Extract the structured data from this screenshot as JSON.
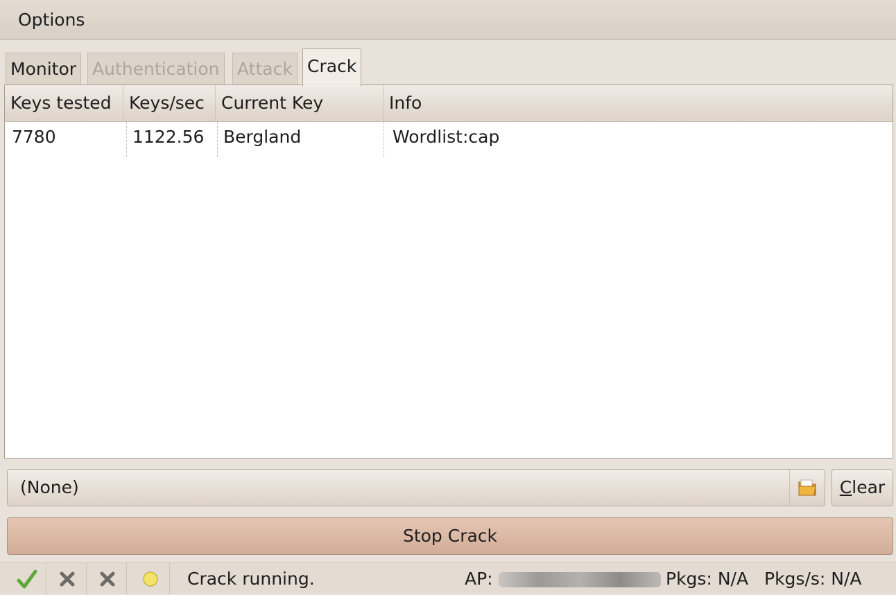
{
  "menu": {
    "options_label": "Options"
  },
  "tabs": [
    {
      "label": "Monitor",
      "state": "enabled"
    },
    {
      "label": "Authentication",
      "state": "disabled"
    },
    {
      "label": "Attack",
      "state": "disabled"
    },
    {
      "label": "Crack",
      "state": "active"
    }
  ],
  "table": {
    "columns": [
      "Keys tested",
      "Keys/sec",
      "Current Key",
      "Info"
    ],
    "rows": [
      [
        "7780",
        "1122.56",
        "Bergland",
        "Wordlist:cap"
      ]
    ]
  },
  "wordlist": {
    "value": "(None)",
    "clear_label": "Clear",
    "icon": "folder-icon"
  },
  "actions": {
    "stop_label": "Stop Crack"
  },
  "status": {
    "icons": [
      "checkmark-icon",
      "cross-icon",
      "cross-icon",
      "yellow-light-icon"
    ],
    "message": "Crack running.",
    "ap_label": "AP:",
    "pkgs_label": "Pkgs:",
    "pkgs_value": "N/A",
    "pkgs_rate_label": "Pkgs/s:",
    "pkgs_rate_value": "N/A"
  },
  "colors": {
    "stop_button": "#d9b7a3",
    "checkmark": "#5ea83a",
    "light": "#f4e36a"
  }
}
